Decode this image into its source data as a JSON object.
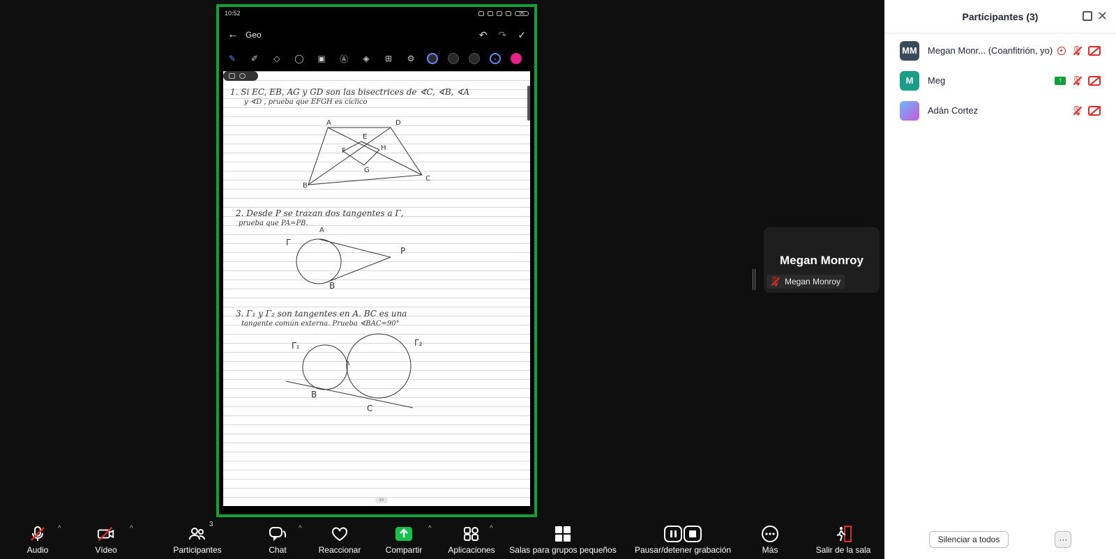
{
  "shared_screen": {
    "status_time": "10:52",
    "battery": "96",
    "note_title": "Geo",
    "page_indicator": "4/5",
    "problem1_line1": "1. Si EC, EB, AG y GD son las bisectrices de ∢C, ∢B, ∢A",
    "problem1_line2": "y ∢D , prueba que EFGH es cíclico",
    "problem1_labels": [
      "A",
      "D",
      "E",
      "F",
      "H",
      "G",
      "B",
      "C"
    ],
    "problem2_line1": "2. Desde P se trazan dos tangentes a Γ,",
    "problem2_line2": "prueba que PA=PB.",
    "problem2_labels": [
      "A",
      "Γ",
      "P",
      "B"
    ],
    "problem3_line1": "3. Γ₁ y Γ₂ son tangentes en A. BC es una",
    "problem3_line2": "tangente común externa. Prueba ∢BAC=90°",
    "problem3_labels": [
      "Γ₁",
      "Γ₂",
      "A",
      "B",
      "C"
    ]
  },
  "video_tile": {
    "name": "Megan Monroy",
    "badge_name": "Megan Monroy"
  },
  "participants_panel": {
    "title": "Participantes (3)",
    "participants": [
      {
        "initials": "MM",
        "name": "Megan Monr... (Coanfitrión, yo)",
        "color": "#3a4a5c"
      },
      {
        "initials": "M",
        "name": "Meg",
        "color": "#1a9e8a"
      },
      {
        "initials": "",
        "name": "Adán Cortez",
        "color": "#6b7fd6"
      }
    ],
    "mute_all_label": "Silenciar a todos",
    "more_label": "···"
  },
  "toolbar": {
    "audio": "Audio",
    "video": "Vídeo",
    "participants": "Participantes",
    "participants_count": "3",
    "chat": "Chat",
    "react": "Reaccionar",
    "share": "Compartir",
    "apps": "Aplicaciones",
    "breakout": "Salas para grupos pequeños",
    "recording": "Pausar/detener grabación",
    "more": "Más",
    "leave": "Salir de la sala"
  },
  "colors": {
    "share_border": "#12a03a",
    "mute_red": "#e02828",
    "share_green": "#12a03a"
  }
}
